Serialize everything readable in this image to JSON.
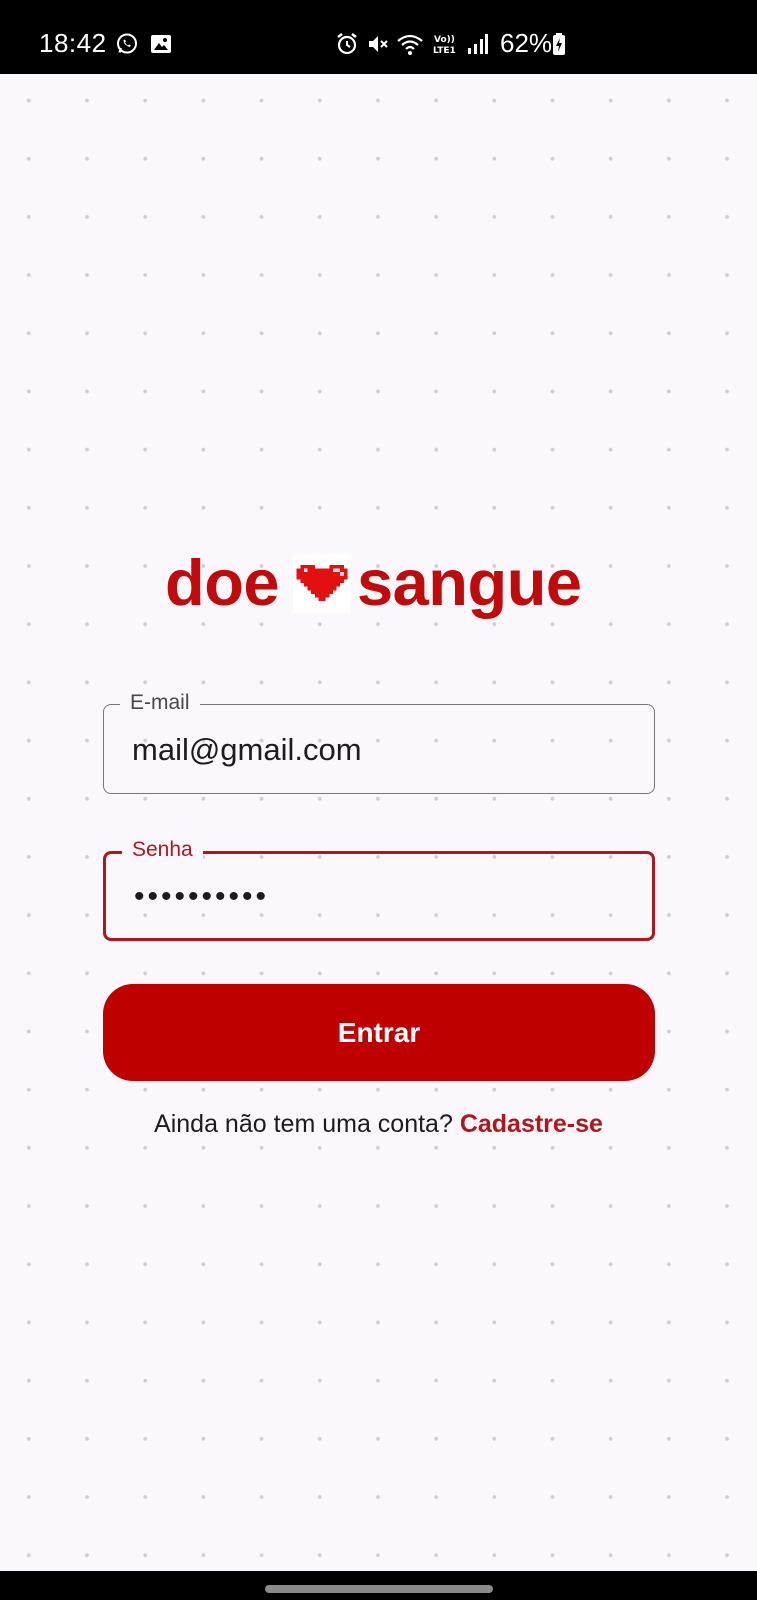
{
  "status_bar": {
    "time": "18:42",
    "battery_percent": "62%",
    "icons": [
      "whatsapp-icon",
      "image-icon",
      "alarm-icon",
      "mute-icon",
      "wifi-icon",
      "volte-icon",
      "signal-icon",
      "battery-charging-icon"
    ]
  },
  "logo": {
    "word_left": "doe",
    "word_right": "sangue",
    "color": "#c10b0b",
    "icon": "pixel-heart-icon"
  },
  "form": {
    "email": {
      "label": "E-mail",
      "value": "mail@gmail.com"
    },
    "password": {
      "label": "Senha",
      "value": "••••••••••",
      "focused": true
    },
    "submit_label": "Entrar",
    "signup_prompt": "Ainda não tem uma conta?",
    "signup_link": "Cadastre-se"
  },
  "colors": {
    "primary": "#bf0000",
    "focus": "#b3151a",
    "background": "#fbf8fd"
  }
}
